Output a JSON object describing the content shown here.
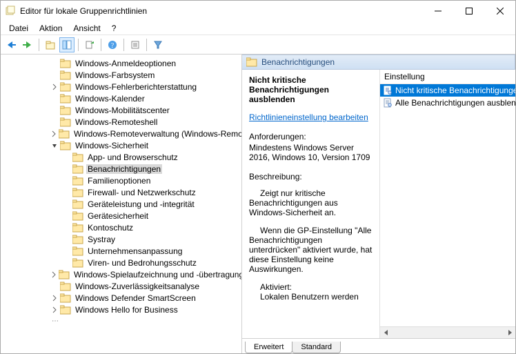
{
  "window": {
    "title": "Editor für lokale Gruppenrichtlinien"
  },
  "menu": {
    "file": "Datei",
    "action": "Aktion",
    "view": "Ansicht",
    "help": "?"
  },
  "section": {
    "header": "Benachrichtigungen"
  },
  "tree": {
    "items": [
      {
        "depth": 4,
        "exp": "",
        "label": "Windows-Anmeldeoptionen"
      },
      {
        "depth": 4,
        "exp": "",
        "label": "Windows-Farbsystem"
      },
      {
        "depth": 4,
        "exp": ">",
        "label": "Windows-Fehlerberichterstattung"
      },
      {
        "depth": 4,
        "exp": "",
        "label": "Windows-Kalender"
      },
      {
        "depth": 4,
        "exp": "",
        "label": "Windows-Mobilitätscenter"
      },
      {
        "depth": 4,
        "exp": "",
        "label": "Windows-Remoteshell"
      },
      {
        "depth": 4,
        "exp": ">",
        "label": "Windows-Remoteverwaltung (Windows-Remotever"
      },
      {
        "depth": 4,
        "exp": "v",
        "label": "Windows-Sicherheit"
      },
      {
        "depth": 5,
        "exp": "",
        "label": "App- und Browserschutz"
      },
      {
        "depth": 5,
        "exp": "",
        "label": "Benachrichtigungen",
        "sel": true
      },
      {
        "depth": 5,
        "exp": "",
        "label": "Familienoptionen"
      },
      {
        "depth": 5,
        "exp": "",
        "label": "Firewall- und Netzwerkschutz"
      },
      {
        "depth": 5,
        "exp": "",
        "label": "Geräteleistung und -integrität"
      },
      {
        "depth": 5,
        "exp": "",
        "label": "Gerätesicherheit"
      },
      {
        "depth": 5,
        "exp": "",
        "label": "Kontoschutz"
      },
      {
        "depth": 5,
        "exp": "",
        "label": "Systray"
      },
      {
        "depth": 5,
        "exp": "",
        "label": "Unternehmensanpassung"
      },
      {
        "depth": 5,
        "exp": "",
        "label": "Viren- und Bedrohungsschutz"
      },
      {
        "depth": 4,
        "exp": ">",
        "label": "Windows-Spielaufzeichnung und -übertragung"
      },
      {
        "depth": 4,
        "exp": "",
        "label": "Windows-Zuverlässigkeitsanalyse"
      },
      {
        "depth": 4,
        "exp": ">",
        "label": "Windows Defender SmartScreen"
      },
      {
        "depth": 4,
        "exp": ">",
        "label": "Windows Hello for Business"
      }
    ]
  },
  "detail": {
    "title": "Nicht kritische Benachrichtigungen ausblenden",
    "edit_link": "Richtlinieneinstellung bearbeiten",
    "req_label": "Anforderungen:",
    "req_text": "Mindestens Windows Server 2016, Windows 10, Version 1709",
    "desc_label": "Beschreibung:",
    "p1": "Zeigt nur kritische Benachrichtigungen aus Windows-Sicherheit an.",
    "p2": "Wenn die GP-Einstellung \"Alle Benachrichtigungen unterdrücken\" aktiviert wurde, hat diese Einstellung keine Auswirkungen.",
    "p3a": "Aktiviert:",
    "p3b": "Lokalen Benutzern werden"
  },
  "list": {
    "col": "Einstellung",
    "rows": [
      {
        "label": "Nicht kritische Benachrichtigungen",
        "sel": true
      },
      {
        "label": "Alle Benachrichtigungen ausblende",
        "sel": false
      }
    ]
  },
  "tabs": {
    "extended": "Erweitert",
    "standard": "Standard"
  }
}
